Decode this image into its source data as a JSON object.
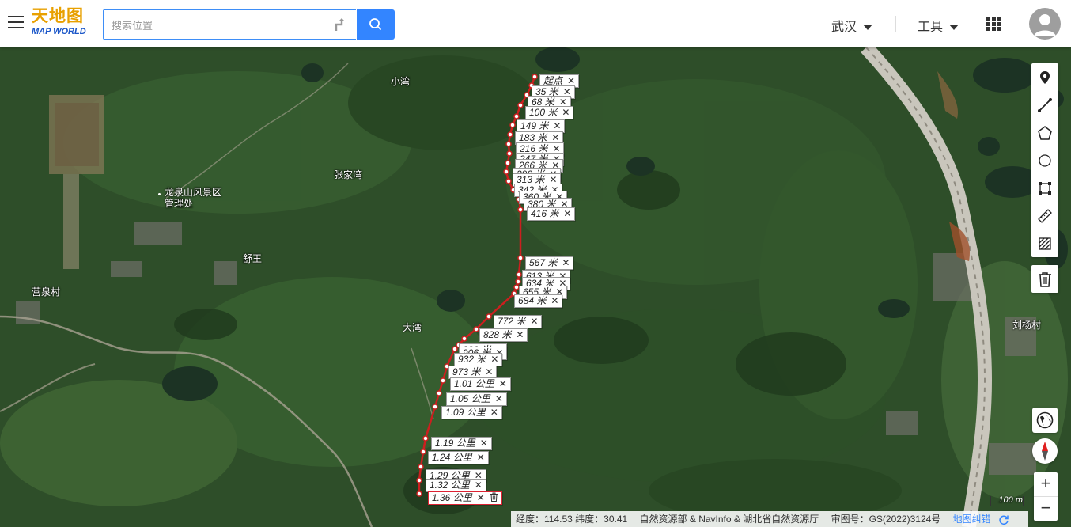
{
  "header": {
    "logo_cn": "天地图",
    "logo_en": "MAP WORLD",
    "search_placeholder": "搜索位置",
    "city": "武汉",
    "tools": "工具"
  },
  "map": {
    "places": {
      "xiaowan": "小湾",
      "zhangjiawan": "张家湾",
      "longquan_line1": "龙泉山风景区",
      "longquan_line2": "管理处",
      "shuwan": "舒王",
      "yingquancun": "营泉村",
      "dawan": "大湾",
      "liuyangcun": "刘杨村"
    },
    "measure_labels": [
      "起点",
      "35 米",
      "68 米",
      "100 米",
      "149 米",
      "183 米",
      "216 米",
      "247 米",
      "266 米",
      "290 米",
      "313 米",
      "342 米",
      "360 米",
      "380 米",
      "416 米",
      "567 米",
      "613 米",
      "634 米",
      "655 米",
      "684 米",
      "772 米",
      "828 米",
      "880 米",
      "906 米",
      "932 米",
      "973 米",
      "1.01 公里",
      "1.05 公里",
      "1.09 公里",
      "1.19 公里",
      "1.24 公里",
      "1.29 公里",
      "1.32 公里",
      "1.36 公里"
    ],
    "close_symbol": "✕",
    "scale": "100 m"
  },
  "footer": {
    "coords": "经度：114.53  纬度：30.41",
    "attribution": "自然资源部 & NavInfo & 湖北省自然资源厅",
    "approval": "审图号：GS(2022)3124号",
    "correction": "地图纠错"
  },
  "zoom": {
    "in": "+",
    "out": "−"
  },
  "colors": {
    "route": "#cc1f1f",
    "accent": "#3385ff",
    "logo_orange": "#e8a000",
    "logo_blue": "#1a56c8"
  },
  "icons": [
    "menu-icon",
    "route-icon",
    "search-icon",
    "apps-icon",
    "user-icon",
    "marker-icon",
    "line-icon",
    "polygon-icon",
    "circle-icon",
    "rectangle-icon",
    "ruler-icon",
    "hatch-icon",
    "trash-icon",
    "globe-icon",
    "compass-icon",
    "refresh-icon"
  ]
}
